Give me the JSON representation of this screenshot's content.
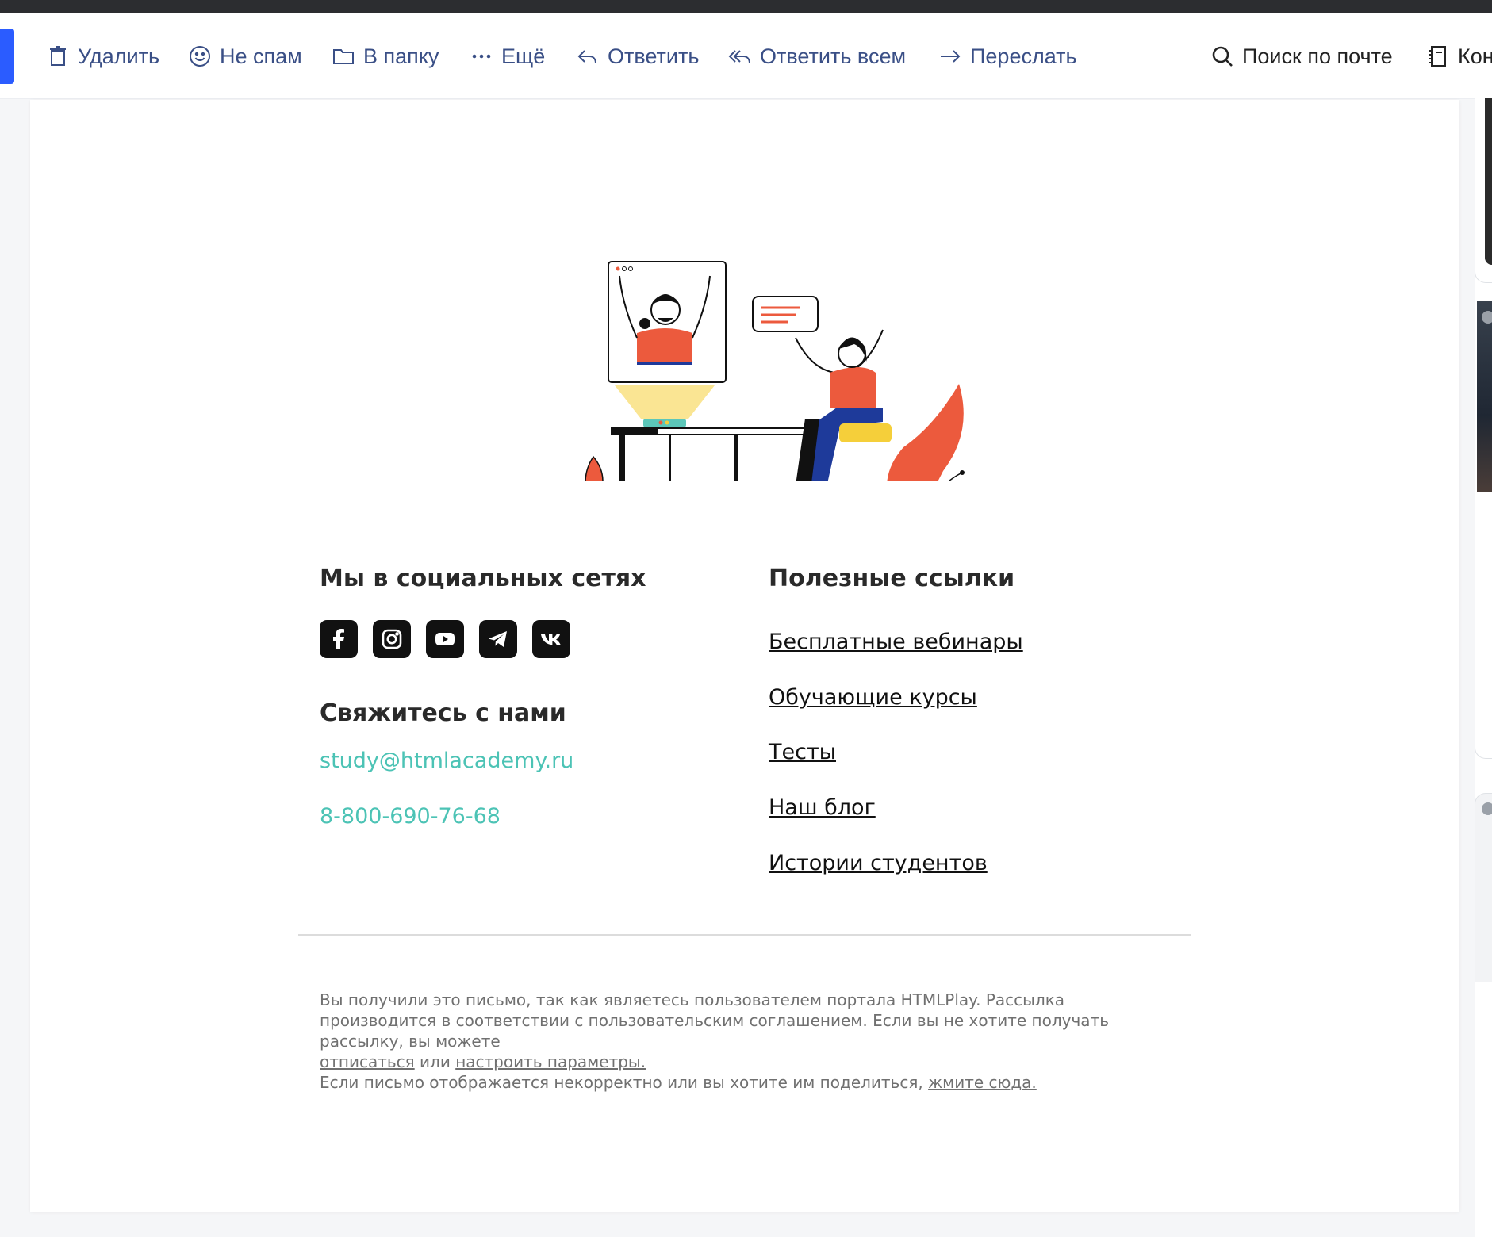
{
  "toolbar": {
    "delete": "Удалить",
    "not_spam": "Не спам",
    "to_folder": "В папку",
    "more": "Ещё",
    "reply": "Ответить",
    "reply_all": "Ответить всем",
    "forward": "Переслать",
    "search": "Поиск по почте",
    "contacts": "Кон"
  },
  "colors": {
    "toolbar_text": "#3a4f86",
    "accent": "#2b5cff",
    "contact_link": "#4cc3b5",
    "illustration_red": "#ec5a3d",
    "illustration_yellow": "#f5cf3a",
    "illustration_blue": "#1e3a9a"
  },
  "icons": {
    "delete": "trash-icon",
    "not_spam": "smiley-icon",
    "to_folder": "folder-icon",
    "more": "dots-icon",
    "reply": "reply-icon",
    "reply_all": "reply-all-icon",
    "forward": "forward-icon",
    "search": "search-icon",
    "contacts": "contacts-book-icon"
  },
  "email": {
    "social_heading": "Мы в социальных сетях",
    "social_icons": [
      "facebook-icon",
      "instagram-icon",
      "youtube-icon",
      "telegram-icon",
      "vk-icon"
    ],
    "contact_heading": "Свяжитесь с нами",
    "contact_email": "study@htmlacademy.ru",
    "contact_phone": "8-800-690-76-68",
    "links_heading": "Полезные ссылки",
    "links": [
      "Бесплатные вебинары",
      "Обучающие курсы",
      "Тесты",
      "Наш блог",
      "Истории студентов"
    ],
    "footer": {
      "notice_text": "Вы получили это письмо, так как являетесь пользователем портала HTMLPlay. Рассылка производится в соответствии с пользовательским соглашением. Если вы не хотите получать рассылку, вы можете",
      "unsubscribe": "отписаться",
      "or": "или",
      "settings": "настроить параметры.",
      "view_text": "Если письмо отображается некорректно или вы хотите им поделиться,",
      "view_link": "жмите сюда."
    }
  }
}
